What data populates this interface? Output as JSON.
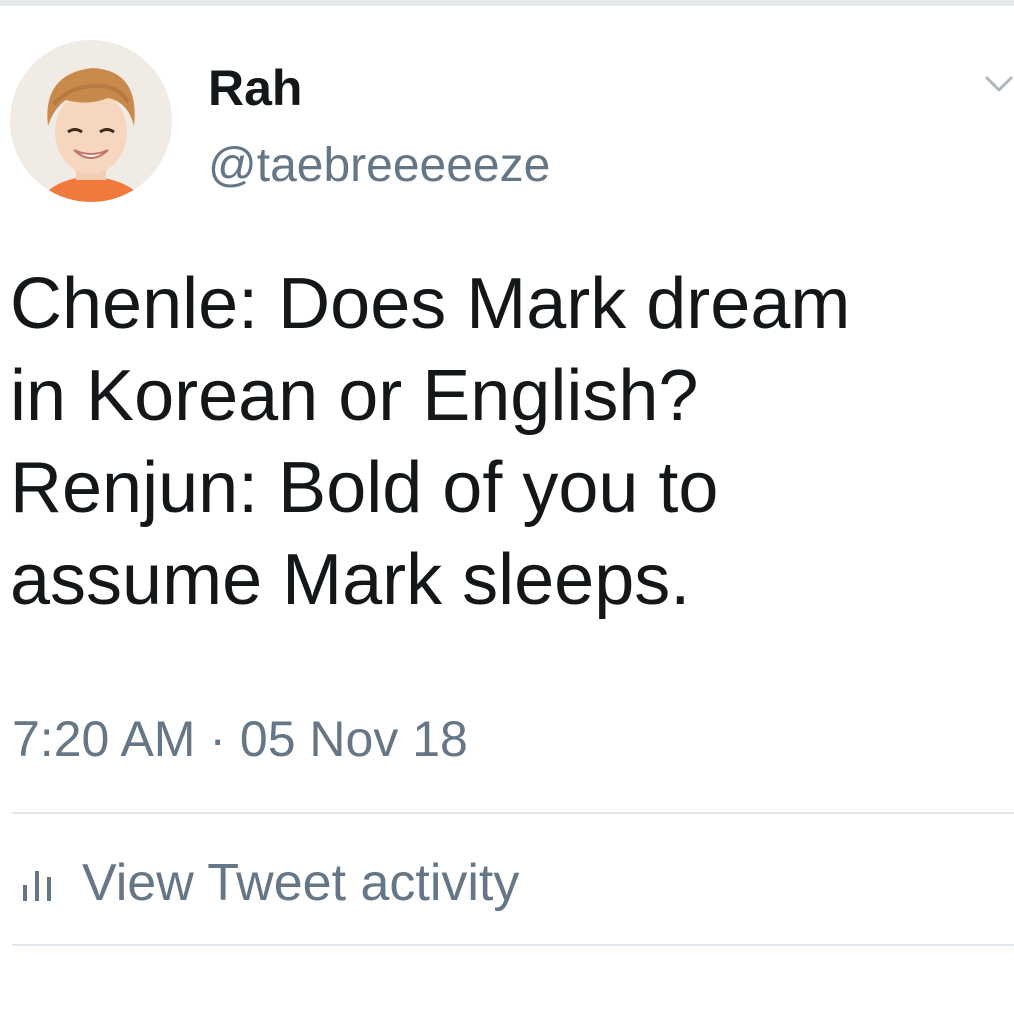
{
  "tweet": {
    "author": {
      "display_name": "Rah",
      "handle": "@taebreeeeeze",
      "avatar_icon": "profile-photo"
    },
    "text_lines": [
      "Chenle: Does Mark dream",
      "in Korean or English?",
      "Renjun: Bold of you to",
      "assume Mark sleeps."
    ],
    "time": "7:20 AM",
    "separator": "·",
    "date": "05 Nov 18",
    "menu_icon": "chevron-down-icon"
  },
  "actions": {
    "activity_label": "View Tweet activity",
    "activity_icon": "bar-chart-icon"
  },
  "colors": {
    "text_primary": "#14171a",
    "text_secondary": "#657786",
    "divider": "#e1e8ed",
    "background": "#ffffff"
  }
}
